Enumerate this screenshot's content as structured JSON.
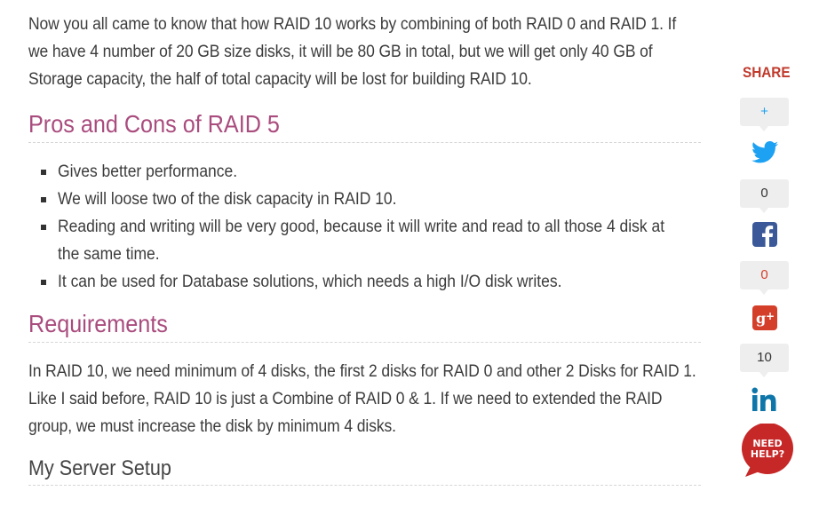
{
  "article": {
    "intro": "Now you all came to know that how RAID 10 works by combining of both RAID 0 and RAID 1. If we have 4 number of 20 GB size disks, it will be 80 GB in total, but we will get only 40 GB of Storage capacity, the half of total capacity will be lost for building RAID 10.",
    "pros_heading": "Pros and Cons of RAID 5",
    "pros_items": [
      "Gives better performance.",
      "We will loose two of the disk capacity in RAID 10.",
      "Reading and writing will be very good, because it will write and read to all those 4 disk at the same time.",
      "It can be used for Database solutions, which needs a high I/O disk writes."
    ],
    "requirements_heading": "Requirements",
    "requirements_text": "In RAID 10, we need minimum of 4 disks, the first 2 disks for RAID 0 and other 2 Disks for RAID 1. Like I said before, RAID 10 is just a Combine of RAID 0 & 1. If we need to extended the RAID group, we must increase the disk by minimum 4 disks.",
    "server_heading": "My Server Setup"
  },
  "share": {
    "label": "SHARE",
    "counts": {
      "plus": "+",
      "facebook": "0",
      "google_plus": "0",
      "linkedin": "10"
    },
    "icons": [
      "twitter-icon",
      "facebook-icon",
      "google-plus-icon",
      "linkedin-icon"
    ],
    "need_help": "NEED HELP?"
  },
  "colors": {
    "heading": "#a94c7e",
    "share_label": "#c0392b",
    "twitter": "#1da1f2",
    "facebook": "#3b5998",
    "google_plus": "#d43f2a",
    "linkedin": "#0e76a8",
    "need_help": "#c62828"
  }
}
